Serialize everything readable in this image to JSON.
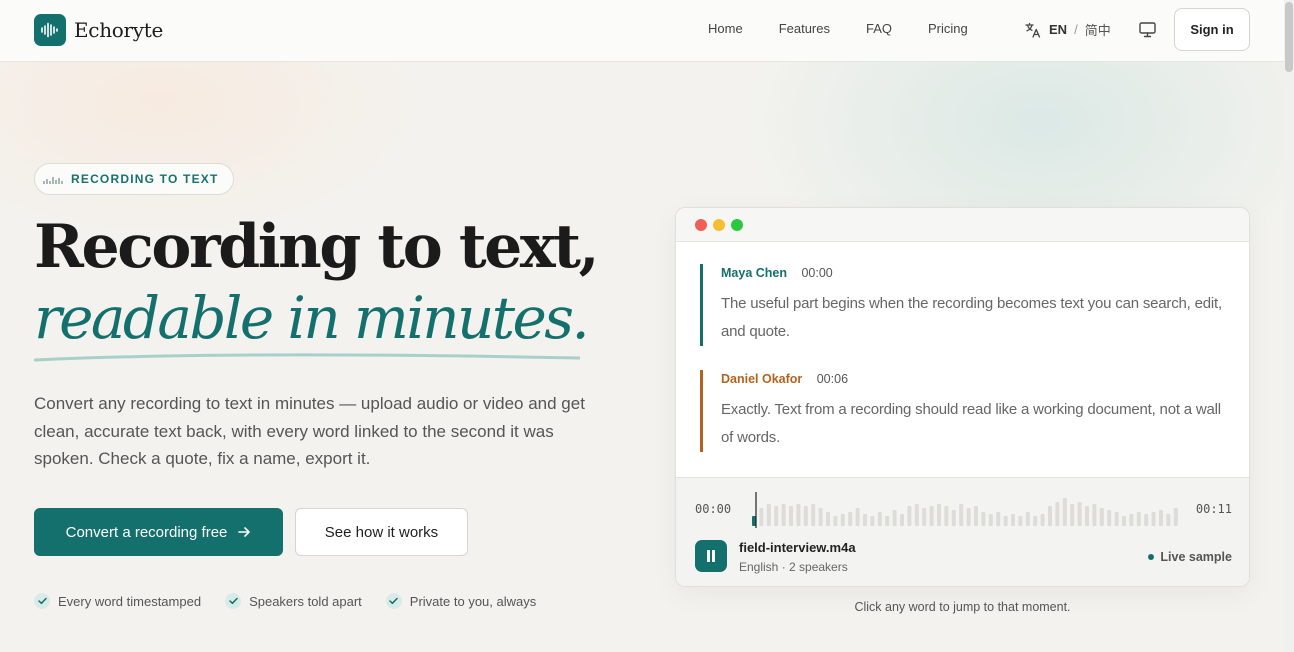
{
  "nav": {
    "brand": "Echoryte",
    "links": [
      "Home",
      "Features",
      "FAQ",
      "Pricing"
    ],
    "lang_current": "EN",
    "lang_separator": "/",
    "lang_alt": "简中",
    "signin_label": "Sign in"
  },
  "hero": {
    "eyebrow": "RECORDING TO TEXT",
    "title_line1": "Recording to text,",
    "title_line2": "readable in minutes.",
    "lede": "Convert any recording to text in minutes — upload audio or video and get clean, accurate text back, with every word linked to the second it was spoken. Check a quote, fix a name, export it.",
    "cta_primary": "Convert a recording free",
    "cta_secondary": "See how it works",
    "checks": [
      "Every word timestamped",
      "Speakers told apart",
      "Private to you, always"
    ]
  },
  "demo": {
    "turns": [
      {
        "speaker": "Maya Chen",
        "time": "00:00",
        "text": "The useful part begins when the recording becomes text you can search, edit, and quote.",
        "color": "#14706d"
      },
      {
        "speaker": "Daniel Okafor",
        "time": "00:06",
        "text": "Exactly. Text from a recording should read like a working document, not a wall of words.",
        "color": "#b5631c"
      }
    ],
    "player": {
      "time_start": "00:00",
      "time_end": "00:11",
      "file_name": "field-interview.m4a",
      "file_meta": "English · 2 speakers",
      "status": "Live sample"
    },
    "hint": "Click any word to jump to that moment."
  },
  "colors": {
    "accent": "#14706d",
    "speaker_b": "#b5631c",
    "window_dots": [
      "#ef5f57",
      "#f6be30",
      "#2bc840"
    ]
  }
}
